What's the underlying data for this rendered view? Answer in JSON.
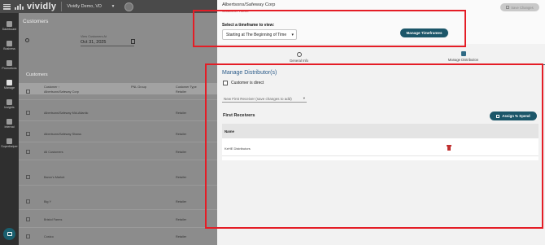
{
  "topbar": {
    "logo_text": "vividly",
    "org_name": "Vividly Demo, VD",
    "org_caret": "▾"
  },
  "sidebar": {
    "items": [
      {
        "label": "Dashboard",
        "icon": "grid-icon"
      },
      {
        "label": "Business",
        "icon": "building-icon"
      },
      {
        "label": "Promotions",
        "icon": "tag-icon"
      },
      {
        "label": "Manage",
        "icon": "people-icon"
      },
      {
        "label": "Insights",
        "icon": "chart-icon"
      },
      {
        "label": "Internal",
        "icon": "wrench-icon"
      },
      {
        "label": "Superlhelper",
        "icon": "user-icon"
      }
    ]
  },
  "background": {
    "title": "Customers",
    "date_label": "View Customers At",
    "date_value": "Oct 31, 2025",
    "customers_title": "Customers",
    "columns": [
      "Customer ↑",
      "PNL Group",
      "Customer Type"
    ],
    "rows": [
      {
        "name": "Albertsons/Safeway Corp",
        "type": "Retailer"
      },
      {
        "name": "Albertsons/Safeway Mid-Atlantic",
        "type": "Retailer"
      },
      {
        "name": "Albertsons/Safeway Shaws",
        "type": "Retailer"
      },
      {
        "name": "All Customers",
        "type": "Retailer"
      },
      {
        "name": "Baron's Market",
        "type": "Retailer"
      },
      {
        "name": "Big Y",
        "type": "Retailer"
      },
      {
        "name": "Bristol Farms",
        "type": "Retailer"
      },
      {
        "name": "Costco",
        "type": "Retailer"
      }
    ]
  },
  "panel": {
    "company": "Albertsons/Safeway Corp",
    "sub_link": "Customer Home",
    "save_label": "Save Changes",
    "timeframe_label": "Select a timeframe to view:",
    "timeframe_value": "Starting at The Beginning of Time",
    "timeframe_caret": "▾",
    "manage_timeframes_label": "Manage Timeframes",
    "tabs": [
      {
        "label": "General Info",
        "icon": "globe-icon"
      },
      {
        "label": "Manage Distribution",
        "icon": "truck-icon"
      }
    ],
    "manage_title": "Manage Distributor(s)",
    "direct_label": "Customer is direct",
    "new_receiver_placeholder": "New First Receiver (save changes to add)",
    "new_receiver_caret": "▾",
    "first_receivers_title": "First Receivers",
    "assign_label": "Assign % Spend",
    "table_header": "Name",
    "receivers": [
      "KeHE Distributors"
    ]
  }
}
